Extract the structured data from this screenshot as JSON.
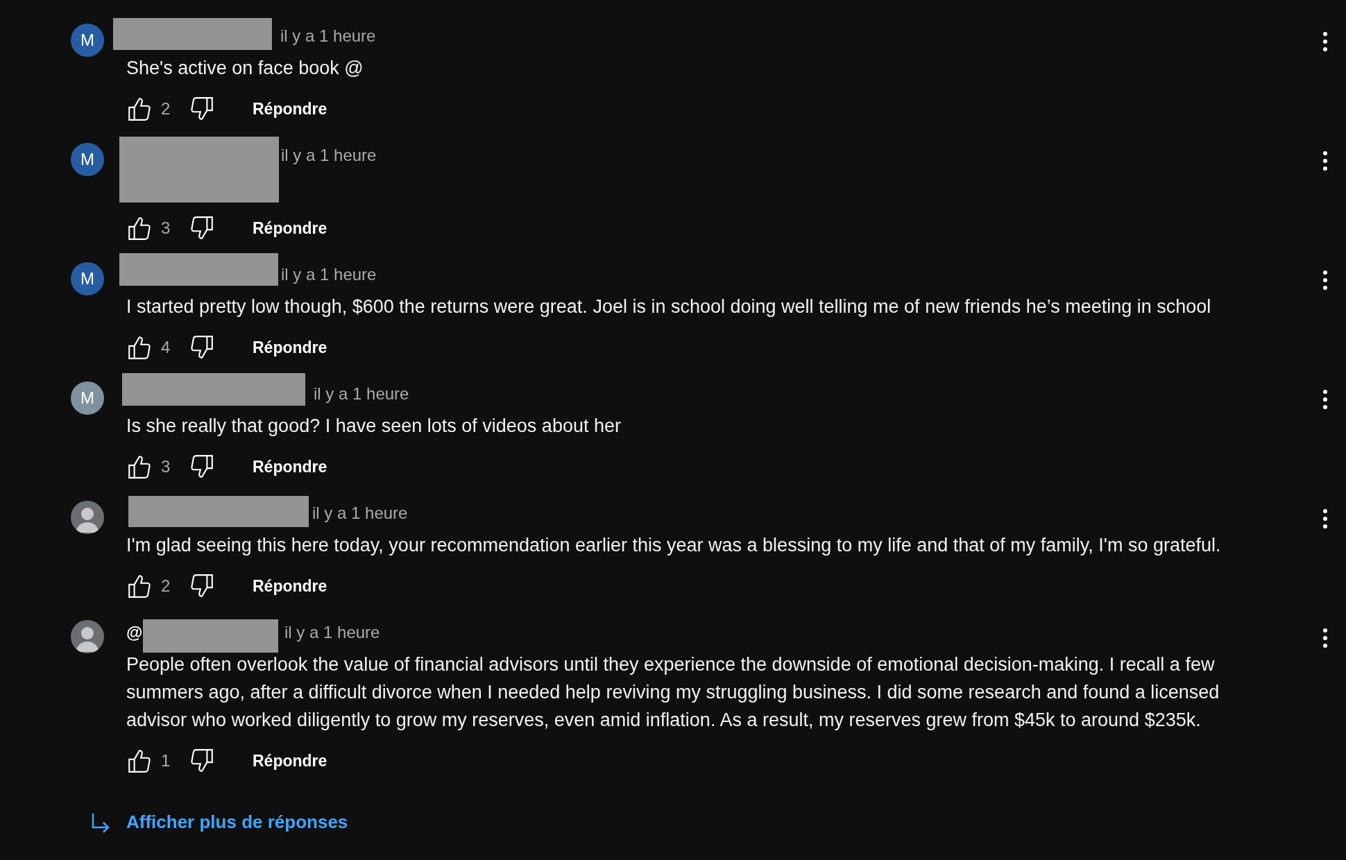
{
  "comments": [
    {
      "avatar": {
        "kind": "letter",
        "letter": "M",
        "color": "#275ea3"
      },
      "time": "il y a 1 heure",
      "text": "She's active on face book @",
      "likes": "2",
      "reply": "Répondre"
    },
    {
      "avatar": {
        "kind": "letter",
        "letter": "M",
        "color": "#275ea3"
      },
      "time": "il y a 1 heure",
      "likes": "3",
      "reply": "Répondre"
    },
    {
      "avatar": {
        "kind": "letter",
        "letter": "M",
        "color": "#275ea3"
      },
      "time": "il y a 1 heure",
      "text": "I started pretty low though, $600 the returns were great. Joel is in school doing well telling me of new friends he’s meeting in school",
      "likes": "4",
      "reply": "Répondre"
    },
    {
      "avatar": {
        "kind": "letter",
        "letter": "M",
        "color": "#7f929f"
      },
      "time": "il y a 1 heure",
      "text": "Is she really that good? I have seen lots of videos about her",
      "likes": "3",
      "reply": "Répondre"
    },
    {
      "avatar": {
        "kind": "photo"
      },
      "time": "il y a 1 heure",
      "text": "I'm glad seeing this here today, your recommendation earlier this year was a blessing to my life and that of my family, I'm so grateful.",
      "likes": "2",
      "reply": "Répondre"
    },
    {
      "avatar": {
        "kind": "photo"
      },
      "author_prefix": "@",
      "time": "il y a 1 heure",
      "text": "People often overlook the value of financial advisors until they experience the downside of emotional decision-making. I recall a few summers ago, after a difficult divorce when I needed help reviving my struggling business. I did some research and found a licensed advisor who worked diligently to grow my reserves, even amid inflation. As a result, my reserves grew from $45k to around $235k.",
      "likes": "1",
      "reply": "Répondre"
    }
  ],
  "more_replies": {
    "label": "Afficher plus de réponses"
  }
}
